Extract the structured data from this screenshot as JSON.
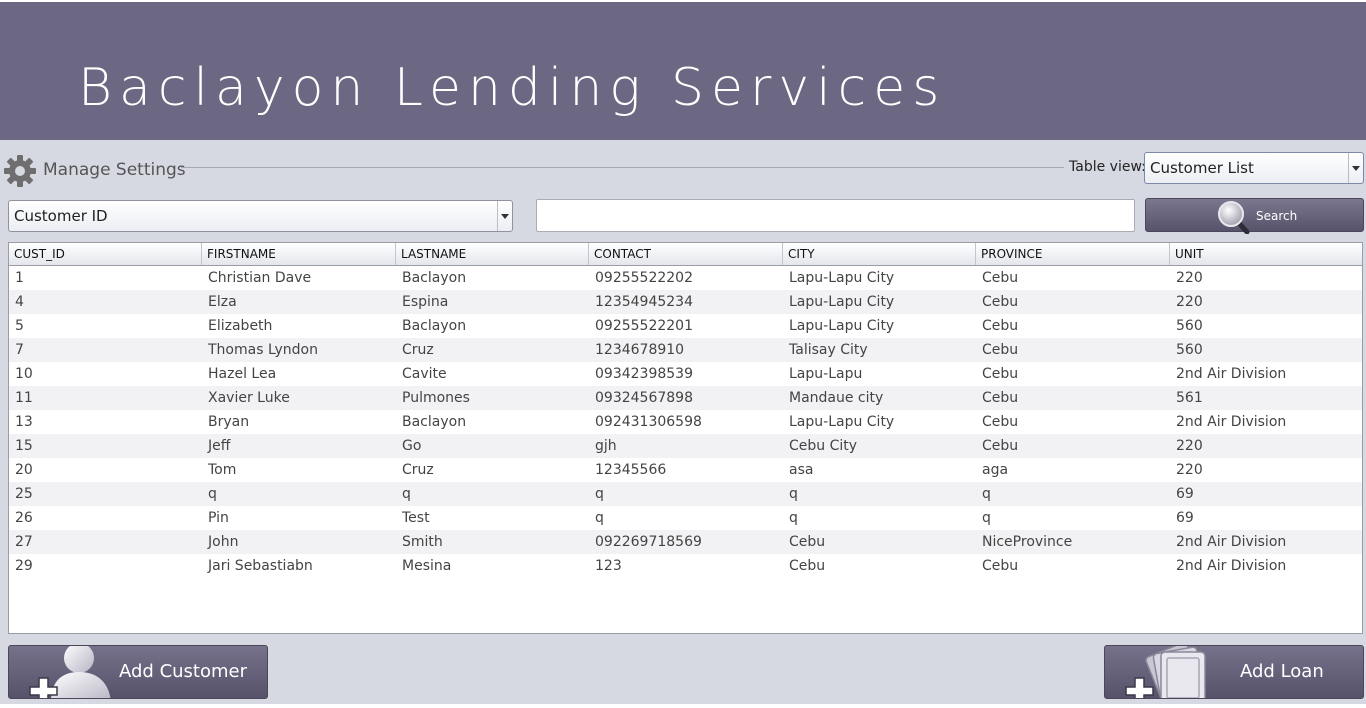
{
  "app": {
    "title": "Baclayon Lending Services"
  },
  "settings": {
    "label": "Manage Settings"
  },
  "table_view": {
    "label": "Table view:",
    "selected": "Customer List"
  },
  "filter": {
    "selected": "Customer ID"
  },
  "search": {
    "value": "",
    "button_label": "Search"
  },
  "table": {
    "columns": [
      "CUST_ID",
      "FIRSTNAME",
      "LASTNAME",
      "CONTACT",
      "CITY",
      "PROVINCE",
      "UNIT"
    ],
    "rows": [
      [
        "1",
        "Christian Dave",
        "Baclayon",
        "09255522202",
        "Lapu-Lapu City",
        "Cebu",
        "220"
      ],
      [
        "4",
        "Elza",
        "Espina",
        "12354945234",
        "Lapu-Lapu City",
        "Cebu",
        "220"
      ],
      [
        "5",
        "Elizabeth",
        "Baclayon",
        "09255522201",
        "Lapu-Lapu City",
        "Cebu",
        "560"
      ],
      [
        "7",
        "Thomas Lyndon",
        "Cruz",
        "1234678910",
        "Talisay City",
        "Cebu",
        "560"
      ],
      [
        "10",
        "Hazel Lea",
        "Cavite",
        "09342398539",
        "Lapu-Lapu",
        "Cebu",
        "2nd Air Division"
      ],
      [
        "11",
        "Xavier Luke",
        "Pulmones",
        "09324567898",
        "Mandaue city",
        "Cebu",
        "561"
      ],
      [
        "13",
        "Bryan",
        "Baclayon",
        "092431306598",
        "Lapu-Lapu City",
        "Cebu",
        "2nd Air Division"
      ],
      [
        "15",
        "Jeff",
        "Go",
        "gjh",
        "Cebu City",
        "Cebu",
        "220"
      ],
      [
        "20",
        "Tom",
        "Cruz",
        "12345566",
        "asa",
        "aga",
        "220"
      ],
      [
        "25",
        "q",
        "q",
        "q",
        "q",
        "q",
        "69"
      ],
      [
        "26",
        "Pin",
        "Test",
        "q",
        "q",
        "q",
        "69"
      ],
      [
        "27",
        "John",
        "Smith",
        "092269718569",
        "Cebu",
        "NiceProvince",
        "2nd Air Division"
      ],
      [
        "29",
        "Jari Sebastiabn",
        "Mesina",
        "123",
        "Cebu",
        "Cebu",
        "2nd Air Division"
      ]
    ]
  },
  "actions": {
    "add_customer_label": "Add Customer",
    "add_loan_label": "Add Loan"
  },
  "colors": {
    "header_bg": "#6c6782",
    "page_bg": "#d6d9e2",
    "button_bg": "#615d75"
  },
  "icons": {
    "settings": "gear-icon",
    "search": "magnifier-icon",
    "add_customer": "add-person-icon",
    "add_loan": "add-money-icon"
  }
}
